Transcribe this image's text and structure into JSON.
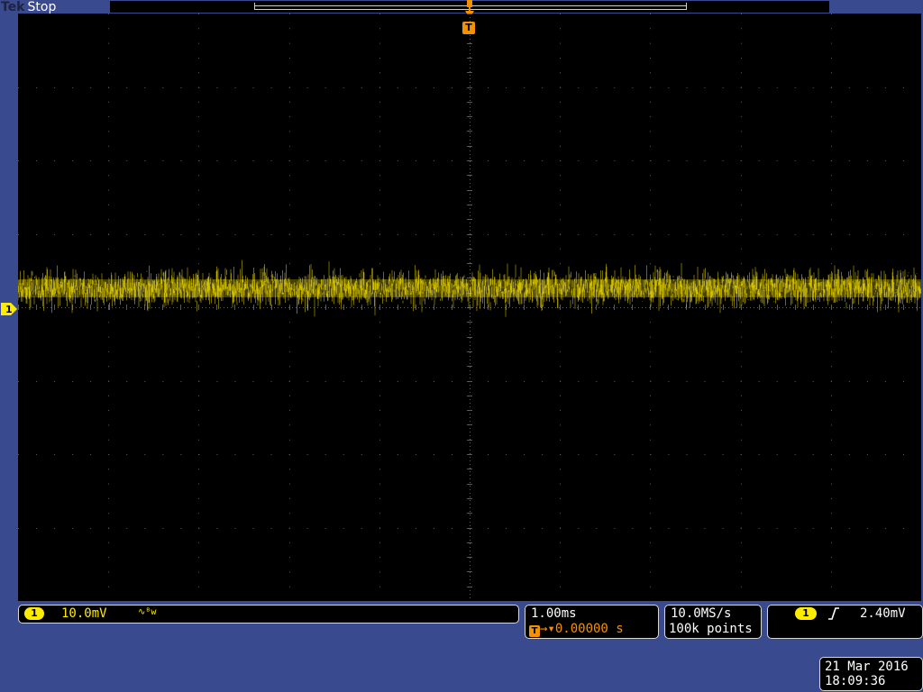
{
  "header": {
    "brand": "Tek",
    "acquisition_state": "Stop"
  },
  "markers": {
    "channel": "1",
    "trigger_position": "T"
  },
  "channel1": {
    "number": "1",
    "scale": "10.0mV",
    "coupling_icon": "∿ᴮw",
    "color": "#ffeb00"
  },
  "horizontal": {
    "scale": "1.00ms",
    "trigger_glyph": "T",
    "delay_arrow": "→▾",
    "delay": "0.00000 s"
  },
  "acquisition": {
    "sample_rate": "10.0MS/s",
    "record_length": "100k points"
  },
  "trigger": {
    "source": "1",
    "slope_icon": "rising-edge-icon",
    "level": "2.40mV",
    "color": "#f39200"
  },
  "datetime": {
    "date": "21 Mar 2016",
    "time": "18:09:36"
  },
  "colors": {
    "frame": "#3a4a8e",
    "screen": "#000000",
    "trace": "#ffeb00",
    "trigger": "#f39200"
  }
}
